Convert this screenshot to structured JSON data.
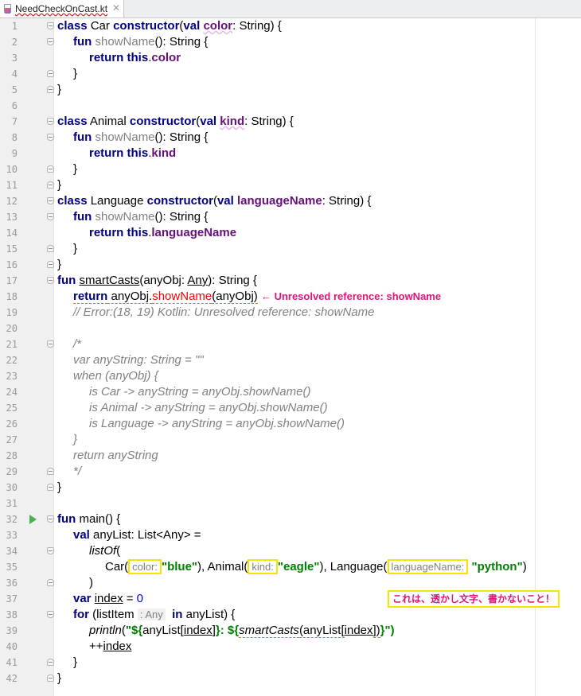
{
  "tab": {
    "file_name": "NeedCheckOnCast.kt",
    "file_icon": "kotlin-file-icon",
    "close_icon": "close-icon"
  },
  "editor": {
    "run_icon": "run-icon",
    "line_numbers": [
      "1",
      "2",
      "3",
      "4",
      "5",
      "6",
      "7",
      "8",
      "9",
      "10",
      "11",
      "12",
      "13",
      "14",
      "15",
      "16",
      "17",
      "18",
      "19",
      "20",
      "21",
      "22",
      "23",
      "24",
      "25",
      "26",
      "27",
      "28",
      "29",
      "30",
      "31",
      "32",
      "33",
      "34",
      "35",
      "36",
      "37",
      "38",
      "39",
      "40",
      "41",
      "42"
    ],
    "code": {
      "l1": [
        "class",
        " Car ",
        "constructor",
        "(",
        "val",
        " ",
        "color",
        ": String) {"
      ],
      "l2": [
        "fun",
        " ",
        "showName",
        "(): String {"
      ],
      "l3": [
        "return",
        " ",
        "this",
        ".",
        "color"
      ],
      "l4": [
        "}"
      ],
      "l5": [
        "}"
      ],
      "l7": [
        "class",
        " Animal ",
        "constructor",
        "(",
        "val",
        " ",
        "kind",
        ": String) {"
      ],
      "l8": [
        "fun",
        " ",
        "showName",
        "(): String {"
      ],
      "l9": [
        "return",
        " ",
        "this",
        ".",
        "kind"
      ],
      "l10": [
        "}"
      ],
      "l11": [
        "}"
      ],
      "l12": [
        "class",
        " Language ",
        "constructor",
        "(",
        "val",
        " ",
        "languageName",
        ": String) {"
      ],
      "l13": [
        "fun",
        " ",
        "showName",
        "(): String {"
      ],
      "l14": [
        "return",
        " ",
        "this",
        ".",
        "languageName"
      ],
      "l15": [
        "}"
      ],
      "l16": [
        "}"
      ],
      "l17": [
        "fun",
        " ",
        "smartCasts",
        "(anyObj: ",
        "Any",
        "): String {"
      ],
      "l18": [
        "return",
        " anyObj.",
        "showName",
        "(anyObj)"
      ],
      "l18_error_note": "← Unresolved reference: showName",
      "l19": "// Error:(18, 19) Kotlin: Unresolved reference: showName",
      "l21": "/*",
      "l22": "var anyString: String = \"\"",
      "l23": "when (anyObj) {",
      "l24": "is Car -> anyString = anyObj.showName()",
      "l25": "is Animal -> anyString = anyObj.showName()",
      "l26": "is Language -> anyString = anyObj.showName()",
      "l27": "}",
      "l28": "return anyString",
      "l29": "*/",
      "l30": [
        "}"
      ],
      "l32": [
        "fun",
        " main() {"
      ],
      "l33": [
        "val",
        " anyList: List<Any> ="
      ],
      "l34": [
        "listOf",
        "("
      ],
      "l35": [
        "Car(",
        "color:",
        "\"blue\"",
        "), Animal(",
        "kind:",
        "\"eagle\"",
        "), Language(",
        "languageName:",
        " ",
        "\"python\"",
        ")"
      ],
      "l36": [
        ")"
      ],
      "l37": [
        "var",
        " ",
        "index",
        " = ",
        "0"
      ],
      "l38": [
        "for",
        " (listItem ",
        ": Any",
        "  ",
        "in",
        " anyList) {"
      ],
      "l39": [
        "println",
        "(",
        "\"${",
        "anyList[",
        "index",
        "]",
        "}",
        ": ",
        "${",
        "smartCasts",
        "(anyList[",
        "index",
        "])",
        "}",
        "\")"
      ],
      "l40": [
        "++",
        "index"
      ],
      "l41": [
        "}"
      ],
      "l42": [
        "}"
      ]
    },
    "annotation_note": "これは、透かし文字、書かないこと！"
  },
  "colors": {
    "keyword": "#000080",
    "field": "#660e7a",
    "string": "#008000",
    "comment": "#808080",
    "number": "#0000ff",
    "error": "#ff0000",
    "annotation": "#e0157a",
    "highlight_box": "#f5e600"
  }
}
